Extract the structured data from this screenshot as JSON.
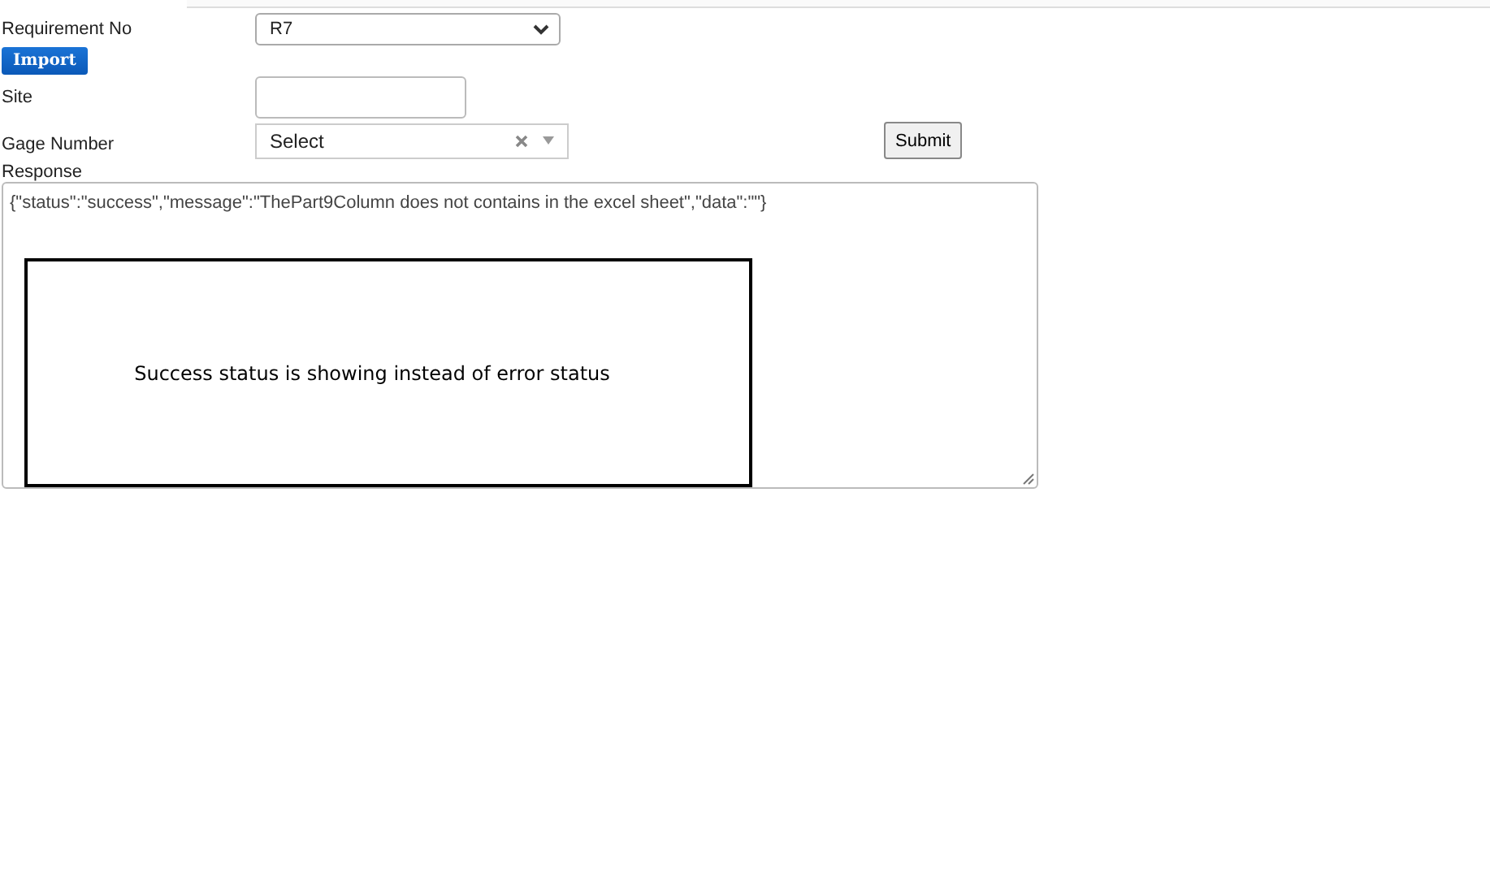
{
  "requirement": {
    "label": "Requirement No",
    "value": "R7"
  },
  "import_button": "Import",
  "site": {
    "label": "Site"
  },
  "gage": {
    "label": "Gage Number",
    "placeholder": "Select"
  },
  "submit_button": "Submit",
  "response": {
    "label": "Response",
    "value": "{\"status\":\"success\",\"message\":\"ThePart9Column does not contains in the excel sheet\",\"data\":\"\"}"
  },
  "annotation": "Success status is showing instead of error status"
}
